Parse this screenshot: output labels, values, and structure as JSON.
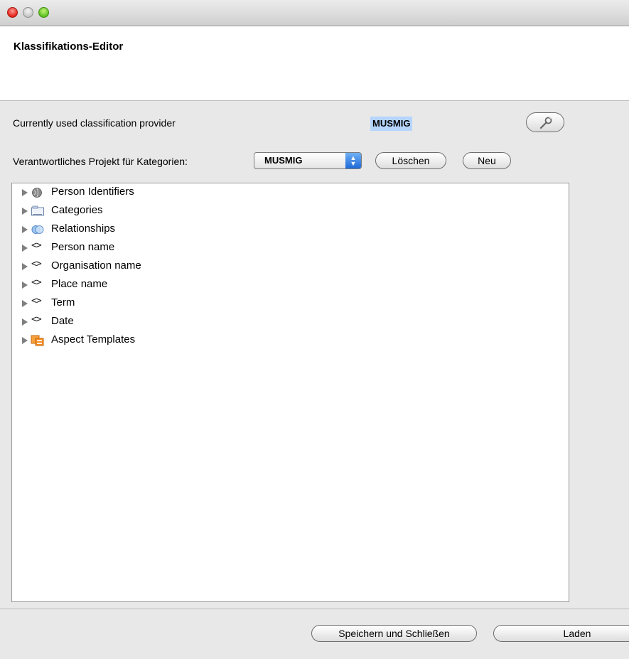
{
  "window": {
    "title": ""
  },
  "header": {
    "title": "Klassifikations-Editor"
  },
  "provider": {
    "label": "Currently used classification provider",
    "value": "MUSMIG",
    "settings_icon": "wrench-icon"
  },
  "project": {
    "label": "Verantwortliches Projekt für Kategorien:",
    "selected": "MUSMIG",
    "delete_label": "Löschen",
    "new_label": "Neu"
  },
  "tree": {
    "items": [
      {
        "label": "Person Identifiers",
        "icon": "sphere-icon"
      },
      {
        "label": "Categories",
        "icon": "folder-icon"
      },
      {
        "label": "Relationships",
        "icon": "link-icon"
      },
      {
        "label": "Person name",
        "icon": "tag-icon"
      },
      {
        "label": "Organisation name",
        "icon": "tag-icon"
      },
      {
        "label": "Place name",
        "icon": "tag-icon"
      },
      {
        "label": "Term",
        "icon": "tag-icon"
      },
      {
        "label": "Date",
        "icon": "tag-icon"
      },
      {
        "label": "Aspect Templates",
        "icon": "template-icon"
      }
    ]
  },
  "footer": {
    "save_close_label": "Speichern und Schließen",
    "load_label": "Laden"
  }
}
